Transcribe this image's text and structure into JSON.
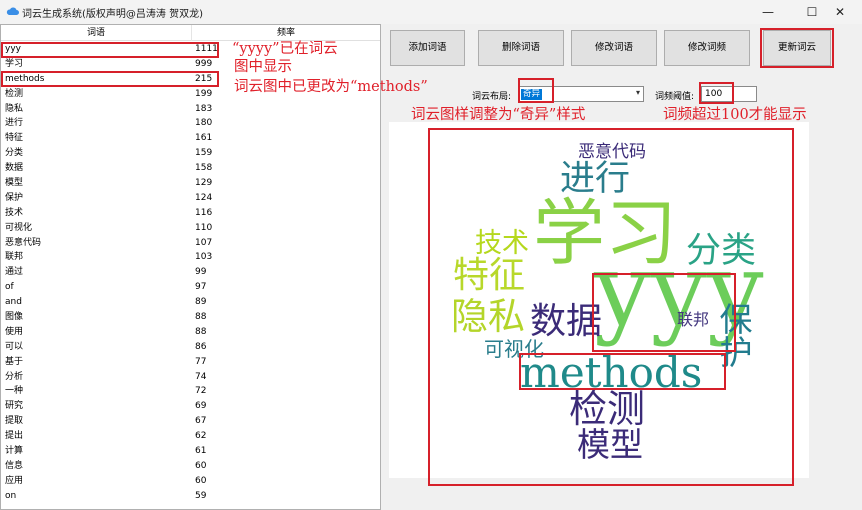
{
  "window": {
    "title": "词云生成系统(版权声明@吕涛涛 贺双龙)",
    "controls": {
      "minimize": "—",
      "maximize": "☐",
      "close": "✕"
    }
  },
  "table": {
    "headers": {
      "word": "词语",
      "freq": "频率"
    },
    "rows": [
      {
        "word": "yyy",
        "freq": "1111"
      },
      {
        "word": "学习",
        "freq": "999"
      },
      {
        "word": "methods",
        "freq": "215"
      },
      {
        "word": "检测",
        "freq": "199"
      },
      {
        "word": "隐私",
        "freq": "183"
      },
      {
        "word": "进行",
        "freq": "180"
      },
      {
        "word": "特征",
        "freq": "161"
      },
      {
        "word": "分类",
        "freq": "159"
      },
      {
        "word": "数据",
        "freq": "158"
      },
      {
        "word": "模型",
        "freq": "129"
      },
      {
        "word": "保护",
        "freq": "124"
      },
      {
        "word": "技术",
        "freq": "116"
      },
      {
        "word": "可视化",
        "freq": "110"
      },
      {
        "word": "恶意代码",
        "freq": "107"
      },
      {
        "word": "联邦",
        "freq": "103"
      },
      {
        "word": "通过",
        "freq": "99"
      },
      {
        "word": "of",
        "freq": "97"
      },
      {
        "word": "and",
        "freq": "89"
      },
      {
        "word": "图像",
        "freq": "88"
      },
      {
        "word": "使用",
        "freq": "88"
      },
      {
        "word": "可以",
        "freq": "86"
      },
      {
        "word": "基于",
        "freq": "77"
      },
      {
        "word": "分析",
        "freq": "74"
      },
      {
        "word": "一种",
        "freq": "72"
      },
      {
        "word": "研究",
        "freq": "69"
      },
      {
        "word": "提取",
        "freq": "67"
      },
      {
        "word": "提出",
        "freq": "62"
      },
      {
        "word": "计算",
        "freq": "61"
      },
      {
        "word": "信息",
        "freq": "60"
      },
      {
        "word": "应用",
        "freq": "60"
      },
      {
        "word": "on",
        "freq": "59"
      }
    ]
  },
  "buttons": {
    "add": "添加词语",
    "delete": "删除词语",
    "edit_word": "修改词语",
    "edit_freq": "修改词频",
    "update": "更新词云"
  },
  "controls": {
    "layout_label": "词云布局:",
    "layout_value": "奇异",
    "threshold_label": "词频阈值:",
    "threshold_value": "100"
  },
  "annotations": {
    "a1_line1": "“yyyy”已在词云",
    "a1_line2": "图中显示",
    "a2": "词云图中已更改为“methods”",
    "a3": "词云图样调整为“奇异”样式",
    "a4": "词频超过100才能显示"
  },
  "cloud": {
    "words": {
      "malicious": "恶意代码",
      "proceed": "进行",
      "learn": "学习",
      "tech": "技术",
      "classify": "分类",
      "feature": "特征",
      "yyy": "yyy",
      "protect": "保护",
      "privacy": "隐私",
      "data": "数据",
      "federated": "联邦",
      "visual": "可视化",
      "methods": "methods",
      "detect": "检测",
      "model": "模型"
    }
  },
  "colors": {
    "annotation_red": "#e0202a",
    "selection_blue": "#0078d7"
  }
}
